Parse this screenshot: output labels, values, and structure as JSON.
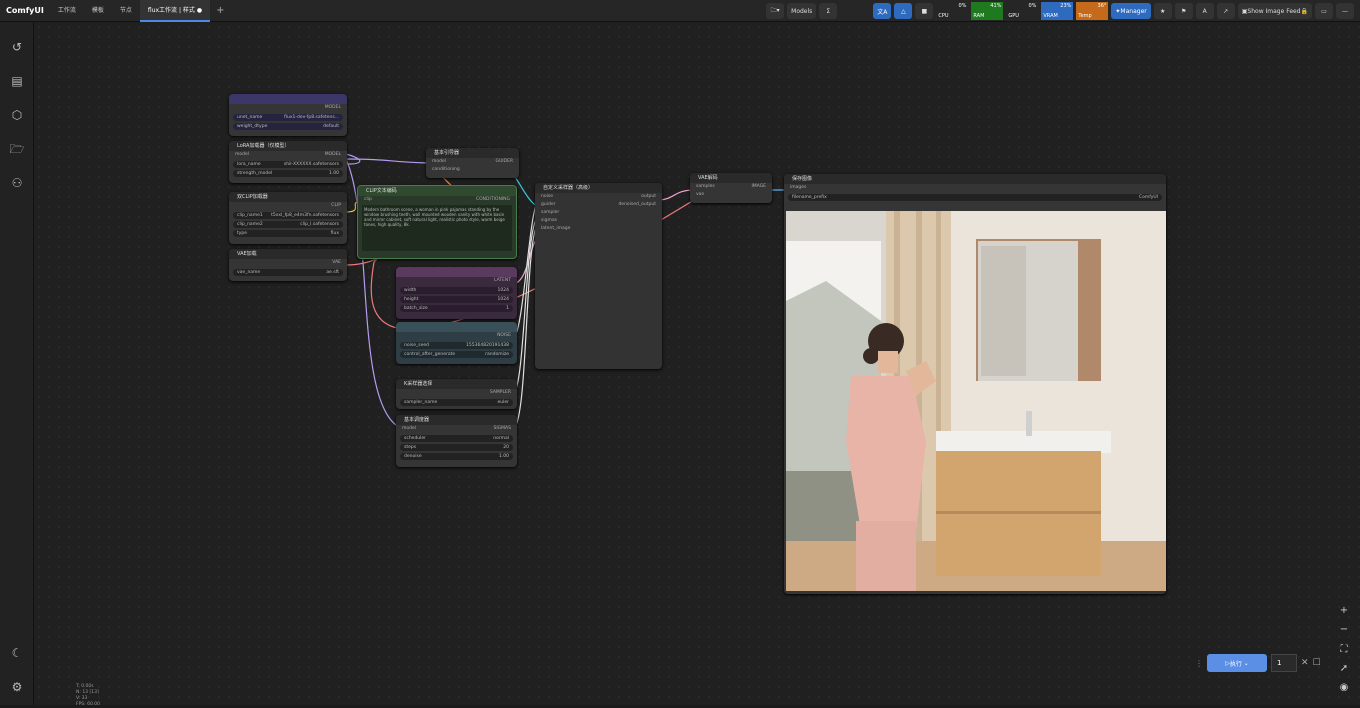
{
  "topbar": {
    "logo": "ComfyUI",
    "tabs": [
      "工作流",
      "模板",
      "节点",
      "flux工作流 | 样式"
    ],
    "models_label": "Models",
    "manager_label": "Manager",
    "show_image_feed_label": "Show Image Feed",
    "meters": [
      {
        "name": "CPU",
        "pct": "0%",
        "color": "#1f7a1f"
      },
      {
        "name": "RAM",
        "pct": "41%",
        "color": "#1f7a1f"
      },
      {
        "name": "GPU",
        "pct": "0%",
        "color": "#1f7a1f"
      },
      {
        "name": "VRAM",
        "pct": "23%",
        "color": "#2e6bbf"
      },
      {
        "name": "Temp",
        "pct": "36°",
        "color": "#c56a1a"
      }
    ]
  },
  "sidebar": {
    "icons": [
      "history-icon",
      "queue-icon",
      "model-library-icon",
      "workflows-icon",
      "node-library-icon"
    ],
    "bottom_icons": [
      "theme-icon",
      "settings-icon"
    ]
  },
  "nodes": {
    "unet": {
      "title": "UNet加载器",
      "output": "MODEL",
      "w1_label": "unet_name",
      "w1_value": "flux1-dev-fp8.safetens...",
      "w2_label": "weight_dtype",
      "w2_value": "default"
    },
    "lora": {
      "title": "LoRA加载器（仅模型）",
      "input": "model",
      "output": "MODEL",
      "w1_label": "lora_name",
      "w1_value": "shil-XXXXXX.safetensors",
      "w2_label": "strength_model",
      "w2_value": "1.00"
    },
    "clip": {
      "title": "双CLIP加载器",
      "output": "CLIP",
      "w1_label": "clip_name1",
      "w1_value": "t5xxl_fp8_e4m3fn.safetensors",
      "w2_label": "clip_name2",
      "w2_value": "clip_l.safetensors",
      "w3_label": "type",
      "w3_value": "flux"
    },
    "vae": {
      "title": "VAE加载",
      "output": "VAE",
      "w1_label": "vae_name",
      "w1_value": "ae.sft"
    },
    "prompt": {
      "title": "CLIP文本编码",
      "input": "clip",
      "output": "CONDITIONING",
      "text": "Modern bathroom scene, a woman in pink pajamas standing by the window brushing teeth, wall mounted wooden vanity with white basin and mirror cabinet, soft natural light, realistic photo style, warm beige tones, high quality, 8k."
    },
    "guider": {
      "title": "基本引导器",
      "inputs": [
        "model",
        "conditioning"
      ],
      "output": "GUIDER"
    },
    "latent": {
      "title": "空Latent图像",
      "output": "LATENT",
      "w1_label": "width",
      "w1_value": "1024",
      "w2_label": "height",
      "w2_value": "1024",
      "w3_label": "batch_size",
      "w3_value": "1"
    },
    "noise": {
      "title": "随机噪波",
      "output": "NOISE",
      "w1_label": "noise_seed",
      "w1_value": "155364820191438",
      "w2_label": "control_after_generate",
      "w2_value": "randomize"
    },
    "ksampler": {
      "title": "K采样器选择",
      "output": "SAMPLER",
      "w1_label": "sampler_name",
      "w1_value": "euler"
    },
    "scheduler": {
      "title": "基本调度器",
      "input": "model",
      "output": "SIGMAS",
      "w1_label": "scheduler",
      "w1_value": "normal",
      "w2_label": "steps",
      "w2_value": "20",
      "w3_label": "denoise",
      "w3_value": "1.00"
    },
    "sampler": {
      "title": "自定义采样器（高级）",
      "inputs": [
        "noise",
        "guider",
        "sampler",
        "sigmas",
        "latent_image"
      ],
      "outputs": [
        "output",
        "denoised_output"
      ]
    },
    "decode": {
      "title": "VAE解码",
      "inputs": [
        "samples",
        "vae"
      ],
      "output": "IMAGE"
    },
    "save": {
      "title": "保存图像",
      "input": "images",
      "w1_label": "filename_prefix",
      "w1_value": "ComfyUI"
    }
  },
  "bottom": {
    "run_label": "执行",
    "queue_count": "1",
    "stats": [
      "T: 0.00s",
      "N: 13 [13]",
      "V: 33",
      "FPS: 60.00"
    ]
  }
}
